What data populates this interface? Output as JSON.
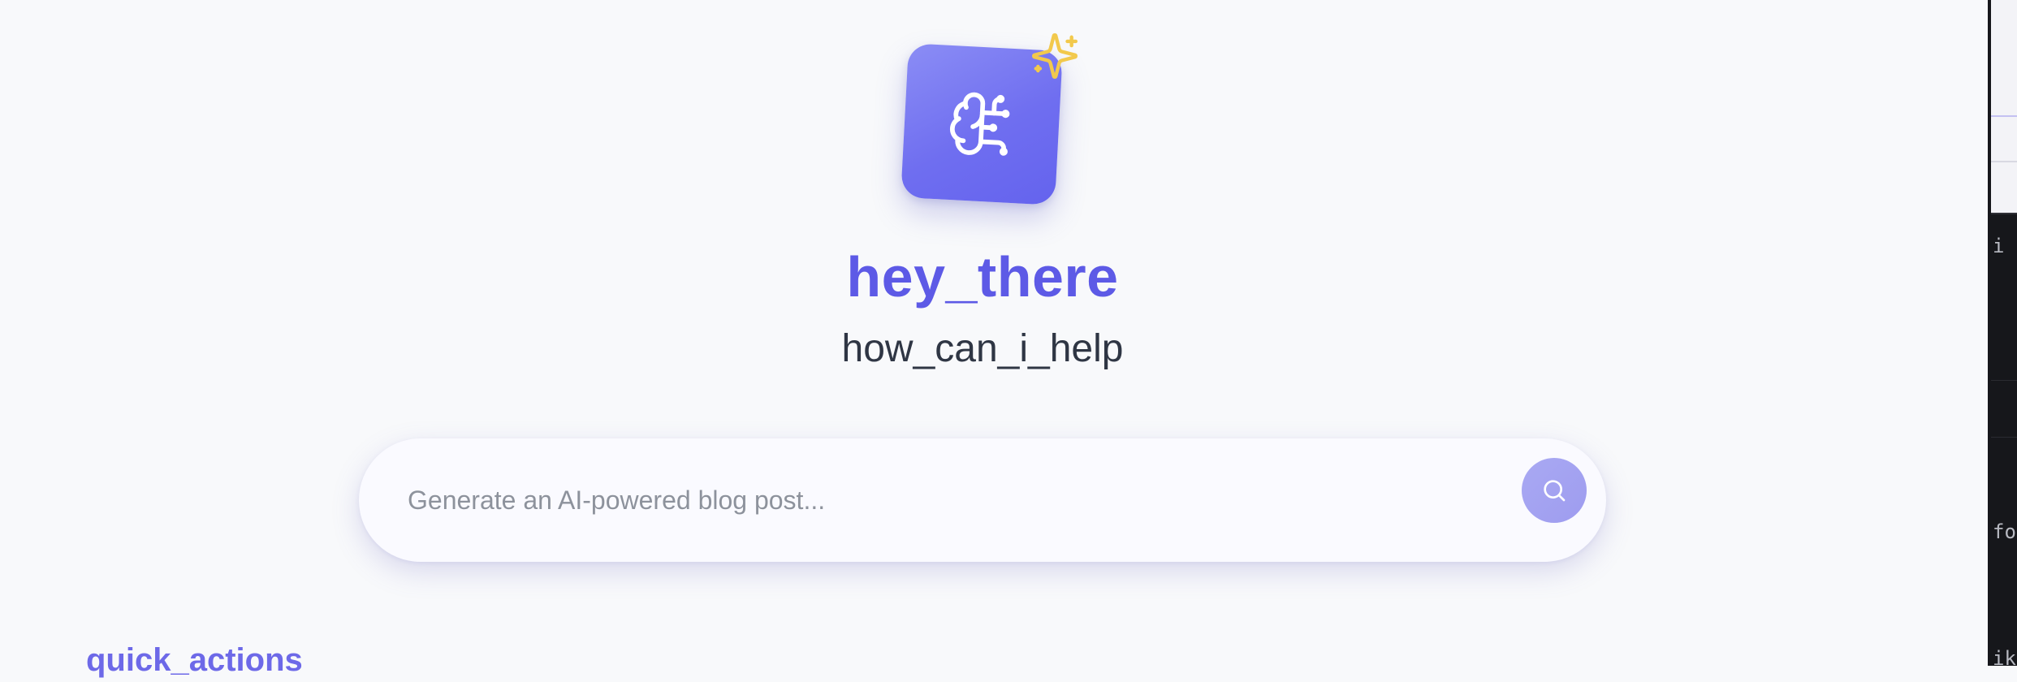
{
  "hero": {
    "title": "hey_there",
    "subtitle": "how_can_i_help",
    "logo_icon": "brain-circuit-icon",
    "badge_icon": "sparkles-icon"
  },
  "search": {
    "placeholder": "Generate an AI-powered blog post...",
    "value": "",
    "button_icon": "search-icon"
  },
  "sections": {
    "quick_actions_heading": "quick_actions"
  },
  "side_window": {
    "fragments": [
      "i c",
      "for",
      "ik"
    ]
  },
  "colors": {
    "accent": "#5d5ae6",
    "logo_gradient_start": "#8b8df5",
    "logo_gradient_end": "#6463ee",
    "sparkle": "#f2c94c",
    "background": "#f8f9fb",
    "subtitle": "#2f3644",
    "search_button": "#a9a9f3"
  }
}
